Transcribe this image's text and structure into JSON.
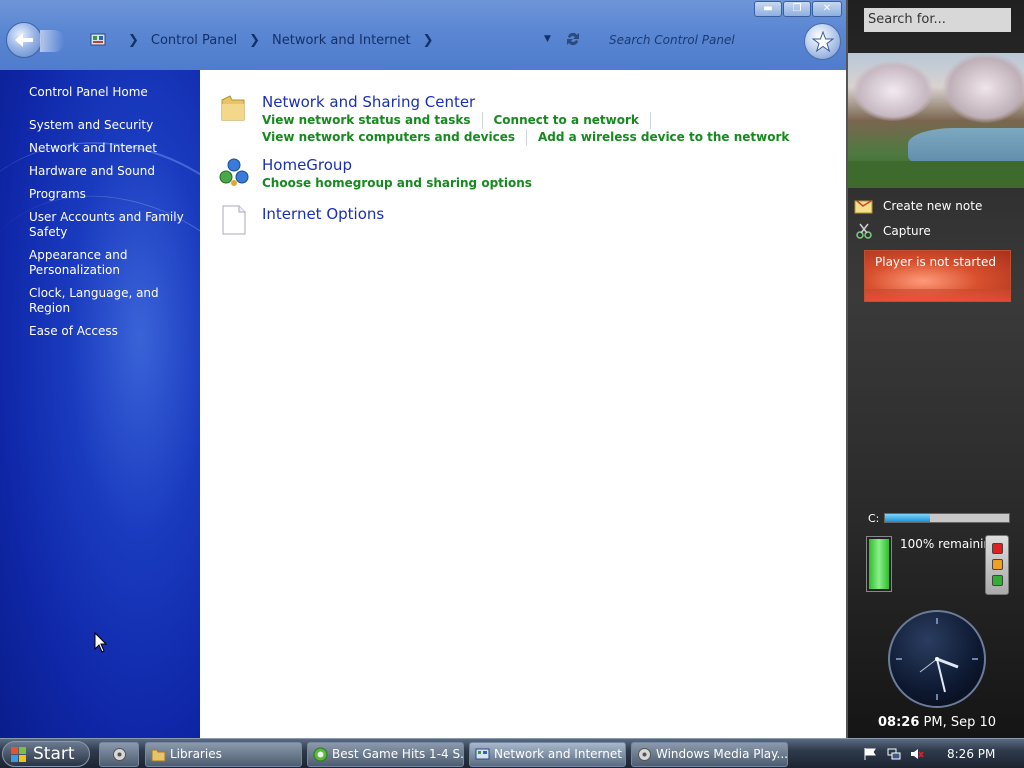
{
  "window": {
    "breadcrumb": [
      "Control Panel",
      "Network and Internet"
    ],
    "search_placeholder": "Search Control Panel",
    "controls": {
      "minimize": "minimize",
      "restore": "restore",
      "close": "close"
    }
  },
  "sidebar": {
    "home": "Control Panel Home",
    "items": [
      {
        "label": "System and Security"
      },
      {
        "label": "Network and Internet"
      },
      {
        "label": "Hardware and Sound"
      },
      {
        "label": "Programs"
      },
      {
        "label": "User Accounts and Family Safety"
      },
      {
        "label": "Appearance and Personalization"
      },
      {
        "label": "Clock, Language, and Region"
      },
      {
        "label": "Ease of Access"
      }
    ]
  },
  "categories": [
    {
      "title": "Network and Sharing Center",
      "icon": "folder-icon",
      "links": [
        "View network status and tasks",
        "Connect to a network",
        "View network computers and devices",
        "Add a wireless device to the network"
      ]
    },
    {
      "title": "HomeGroup",
      "icon": "homegroup-icon",
      "links": [
        "Choose homegroup and sharing options"
      ]
    },
    {
      "title": "Internet Options",
      "icon": "document-icon",
      "links": []
    }
  ],
  "gadgets": {
    "search_placeholder": "Search for...",
    "notes": [
      {
        "label": "Create new note",
        "icon": "note-icon"
      },
      {
        "label": "Capture",
        "icon": "scissors-icon"
      }
    ],
    "player_status": "Player is not started",
    "drive": {
      "label": "C:",
      "used_fraction": 0.36
    },
    "battery": {
      "text": "100% remaining",
      "level": 1.0
    },
    "clock": {
      "time": "08:26",
      "suffix": "PM, Sep 10"
    }
  },
  "taskbar": {
    "start": "Start",
    "items": [
      {
        "label": "Libraries",
        "icon": "folder-icon"
      },
      {
        "label": "Best Game Hits 1-4 S...",
        "icon": "browser-icon"
      },
      {
        "label": "Network and Internet",
        "icon": "control-panel-icon"
      },
      {
        "label": "Windows Media Play...",
        "icon": "media-player-icon"
      }
    ],
    "tray_time": "8:26 PM"
  },
  "colors": {
    "titlebar": "#5a86d2",
    "sidebar": "#1a3bbf",
    "category_title": "#1a2fb8",
    "task_link": "#168a1e"
  }
}
